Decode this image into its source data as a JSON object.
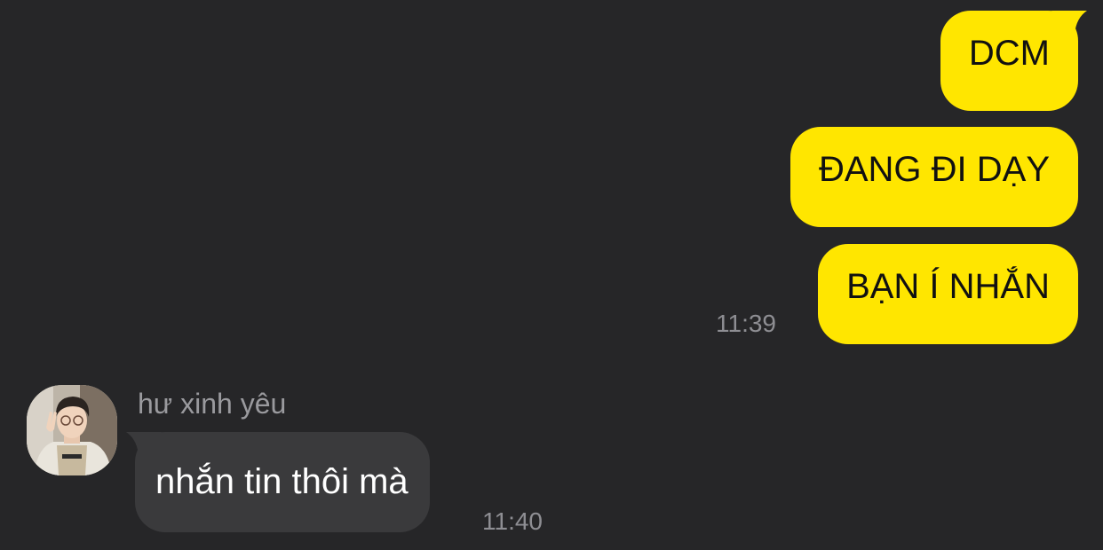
{
  "colors": {
    "background": "#262628",
    "outgoing_bubble": "#FFE600",
    "outgoing_text": "#111111",
    "incoming_bubble": "#3A3A3C",
    "incoming_text": "#FFFFFF",
    "timestamp": "#8E8E93"
  },
  "outgoing": {
    "messages": [
      {
        "text": "DCM"
      },
      {
        "text": "ĐANG ĐI DẠY"
      },
      {
        "text": "BẠN Í NHẮN"
      }
    ],
    "time": "11:39"
  },
  "incoming": {
    "sender_name": "hư xinh yêu",
    "avatar_icon": "profile-photo",
    "messages": [
      {
        "text": "nhắn tin thôi mà"
      }
    ],
    "time": "11:40"
  }
}
